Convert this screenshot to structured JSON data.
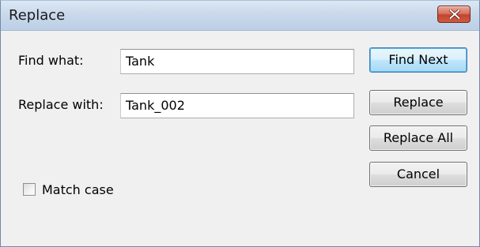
{
  "window": {
    "title": "Replace"
  },
  "form": {
    "find_label": "Find what:",
    "find_value": "Tank",
    "replace_label": "Replace with:",
    "replace_value": "Tank_002",
    "match_case_label": "Match case",
    "match_case_checked": false
  },
  "buttons": {
    "find_next": "Find Next",
    "replace": "Replace",
    "replace_all": "Replace All",
    "cancel": "Cancel"
  },
  "icons": {
    "close": "close-icon"
  },
  "colors": {
    "close_button": "#c4452f",
    "default_button_border": "#3c7fb1",
    "titlebar": "#cad9eb",
    "dialog_background": "#f0f0f0"
  }
}
